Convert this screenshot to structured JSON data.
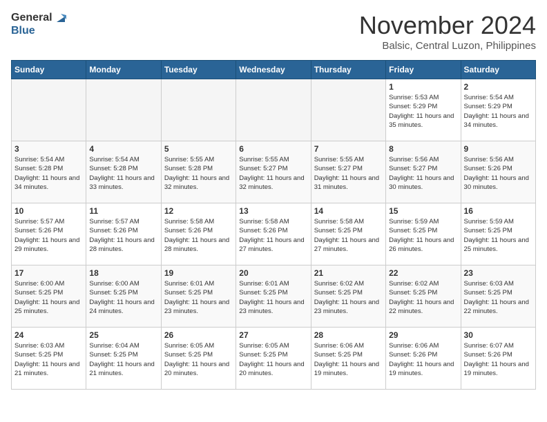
{
  "header": {
    "logo_general": "General",
    "logo_blue": "Blue",
    "month": "November 2024",
    "location": "Balsic, Central Luzon, Philippines"
  },
  "days_of_week": [
    "Sunday",
    "Monday",
    "Tuesday",
    "Wednesday",
    "Thursday",
    "Friday",
    "Saturday"
  ],
  "weeks": [
    [
      {
        "day": null
      },
      {
        "day": null
      },
      {
        "day": null
      },
      {
        "day": null
      },
      {
        "day": null
      },
      {
        "day": "1",
        "sunrise": "Sunrise: 5:53 AM",
        "sunset": "Sunset: 5:29 PM",
        "daylight": "Daylight: 11 hours and 35 minutes."
      },
      {
        "day": "2",
        "sunrise": "Sunrise: 5:54 AM",
        "sunset": "Sunset: 5:29 PM",
        "daylight": "Daylight: 11 hours and 34 minutes."
      }
    ],
    [
      {
        "day": "3",
        "sunrise": "Sunrise: 5:54 AM",
        "sunset": "Sunset: 5:28 PM",
        "daylight": "Daylight: 11 hours and 34 minutes."
      },
      {
        "day": "4",
        "sunrise": "Sunrise: 5:54 AM",
        "sunset": "Sunset: 5:28 PM",
        "daylight": "Daylight: 11 hours and 33 minutes."
      },
      {
        "day": "5",
        "sunrise": "Sunrise: 5:55 AM",
        "sunset": "Sunset: 5:28 PM",
        "daylight": "Daylight: 11 hours and 32 minutes."
      },
      {
        "day": "6",
        "sunrise": "Sunrise: 5:55 AM",
        "sunset": "Sunset: 5:27 PM",
        "daylight": "Daylight: 11 hours and 32 minutes."
      },
      {
        "day": "7",
        "sunrise": "Sunrise: 5:55 AM",
        "sunset": "Sunset: 5:27 PM",
        "daylight": "Daylight: 11 hours and 31 minutes."
      },
      {
        "day": "8",
        "sunrise": "Sunrise: 5:56 AM",
        "sunset": "Sunset: 5:27 PM",
        "daylight": "Daylight: 11 hours and 30 minutes."
      },
      {
        "day": "9",
        "sunrise": "Sunrise: 5:56 AM",
        "sunset": "Sunset: 5:26 PM",
        "daylight": "Daylight: 11 hours and 30 minutes."
      }
    ],
    [
      {
        "day": "10",
        "sunrise": "Sunrise: 5:57 AM",
        "sunset": "Sunset: 5:26 PM",
        "daylight": "Daylight: 11 hours and 29 minutes."
      },
      {
        "day": "11",
        "sunrise": "Sunrise: 5:57 AM",
        "sunset": "Sunset: 5:26 PM",
        "daylight": "Daylight: 11 hours and 28 minutes."
      },
      {
        "day": "12",
        "sunrise": "Sunrise: 5:58 AM",
        "sunset": "Sunset: 5:26 PM",
        "daylight": "Daylight: 11 hours and 28 minutes."
      },
      {
        "day": "13",
        "sunrise": "Sunrise: 5:58 AM",
        "sunset": "Sunset: 5:26 PM",
        "daylight": "Daylight: 11 hours and 27 minutes."
      },
      {
        "day": "14",
        "sunrise": "Sunrise: 5:58 AM",
        "sunset": "Sunset: 5:25 PM",
        "daylight": "Daylight: 11 hours and 27 minutes."
      },
      {
        "day": "15",
        "sunrise": "Sunrise: 5:59 AM",
        "sunset": "Sunset: 5:25 PM",
        "daylight": "Daylight: 11 hours and 26 minutes."
      },
      {
        "day": "16",
        "sunrise": "Sunrise: 5:59 AM",
        "sunset": "Sunset: 5:25 PM",
        "daylight": "Daylight: 11 hours and 25 minutes."
      }
    ],
    [
      {
        "day": "17",
        "sunrise": "Sunrise: 6:00 AM",
        "sunset": "Sunset: 5:25 PM",
        "daylight": "Daylight: 11 hours and 25 minutes."
      },
      {
        "day": "18",
        "sunrise": "Sunrise: 6:00 AM",
        "sunset": "Sunset: 5:25 PM",
        "daylight": "Daylight: 11 hours and 24 minutes."
      },
      {
        "day": "19",
        "sunrise": "Sunrise: 6:01 AM",
        "sunset": "Sunset: 5:25 PM",
        "daylight": "Daylight: 11 hours and 23 minutes."
      },
      {
        "day": "20",
        "sunrise": "Sunrise: 6:01 AM",
        "sunset": "Sunset: 5:25 PM",
        "daylight": "Daylight: 11 hours and 23 minutes."
      },
      {
        "day": "21",
        "sunrise": "Sunrise: 6:02 AM",
        "sunset": "Sunset: 5:25 PM",
        "daylight": "Daylight: 11 hours and 23 minutes."
      },
      {
        "day": "22",
        "sunrise": "Sunrise: 6:02 AM",
        "sunset": "Sunset: 5:25 PM",
        "daylight": "Daylight: 11 hours and 22 minutes."
      },
      {
        "day": "23",
        "sunrise": "Sunrise: 6:03 AM",
        "sunset": "Sunset: 5:25 PM",
        "daylight": "Daylight: 11 hours and 22 minutes."
      }
    ],
    [
      {
        "day": "24",
        "sunrise": "Sunrise: 6:03 AM",
        "sunset": "Sunset: 5:25 PM",
        "daylight": "Daylight: 11 hours and 21 minutes."
      },
      {
        "day": "25",
        "sunrise": "Sunrise: 6:04 AM",
        "sunset": "Sunset: 5:25 PM",
        "daylight": "Daylight: 11 hours and 21 minutes."
      },
      {
        "day": "26",
        "sunrise": "Sunrise: 6:05 AM",
        "sunset": "Sunset: 5:25 PM",
        "daylight": "Daylight: 11 hours and 20 minutes."
      },
      {
        "day": "27",
        "sunrise": "Sunrise: 6:05 AM",
        "sunset": "Sunset: 5:25 PM",
        "daylight": "Daylight: 11 hours and 20 minutes."
      },
      {
        "day": "28",
        "sunrise": "Sunrise: 6:06 AM",
        "sunset": "Sunset: 5:25 PM",
        "daylight": "Daylight: 11 hours and 19 minutes."
      },
      {
        "day": "29",
        "sunrise": "Sunrise: 6:06 AM",
        "sunset": "Sunset: 5:26 PM",
        "daylight": "Daylight: 11 hours and 19 minutes."
      },
      {
        "day": "30",
        "sunrise": "Sunrise: 6:07 AM",
        "sunset": "Sunset: 5:26 PM",
        "daylight": "Daylight: 11 hours and 19 minutes."
      }
    ]
  ]
}
